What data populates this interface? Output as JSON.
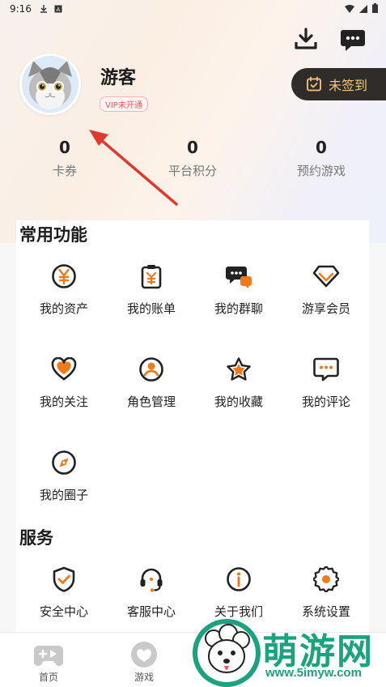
{
  "status_bar": {
    "time": "9:16"
  },
  "profile": {
    "username": "游客",
    "vip_status": "VIP未开通",
    "signin_label": "未签到"
  },
  "stats": [
    {
      "value": "0",
      "label": "卡券"
    },
    {
      "value": "0",
      "label": "平台积分"
    },
    {
      "value": "0",
      "label": "预约游戏"
    }
  ],
  "common": {
    "title": "常用功能",
    "items": [
      {
        "label": "我的资产",
        "icon": "yen-coin-icon"
      },
      {
        "label": "我的账单",
        "icon": "bill-clipboard-icon"
      },
      {
        "label": "我的群聊",
        "icon": "group-chat-icon"
      },
      {
        "label": "游享会员",
        "icon": "diamond-icon"
      },
      {
        "label": "我的关注",
        "icon": "heart-icon"
      },
      {
        "label": "角色管理",
        "icon": "user-circle-icon"
      },
      {
        "label": "我的收藏",
        "icon": "star-icon"
      },
      {
        "label": "我的评论",
        "icon": "comment-icon"
      },
      {
        "label": "我的圈子",
        "icon": "compass-icon"
      }
    ]
  },
  "services": {
    "title": "服务",
    "items": [
      {
        "label": "安全中心",
        "icon": "shield-check-icon"
      },
      {
        "label": "客服中心",
        "icon": "headset-icon"
      },
      {
        "label": "关于我们",
        "icon": "info-icon"
      },
      {
        "label": "系统设置",
        "icon": "gear-icon"
      }
    ]
  },
  "tabbar": {
    "items": [
      {
        "label": "首页",
        "icon": "gamepad-icon"
      },
      {
        "label": "游戏",
        "icon": "heart-bubble-icon"
      }
    ]
  },
  "watermark": {
    "brand": "萌游网",
    "url": "www.5imyw.com"
  },
  "colors": {
    "accent": "#f07a1a",
    "dark": "#2f2c29",
    "gold": "#f2c880",
    "watermark": "#1aa37e"
  }
}
